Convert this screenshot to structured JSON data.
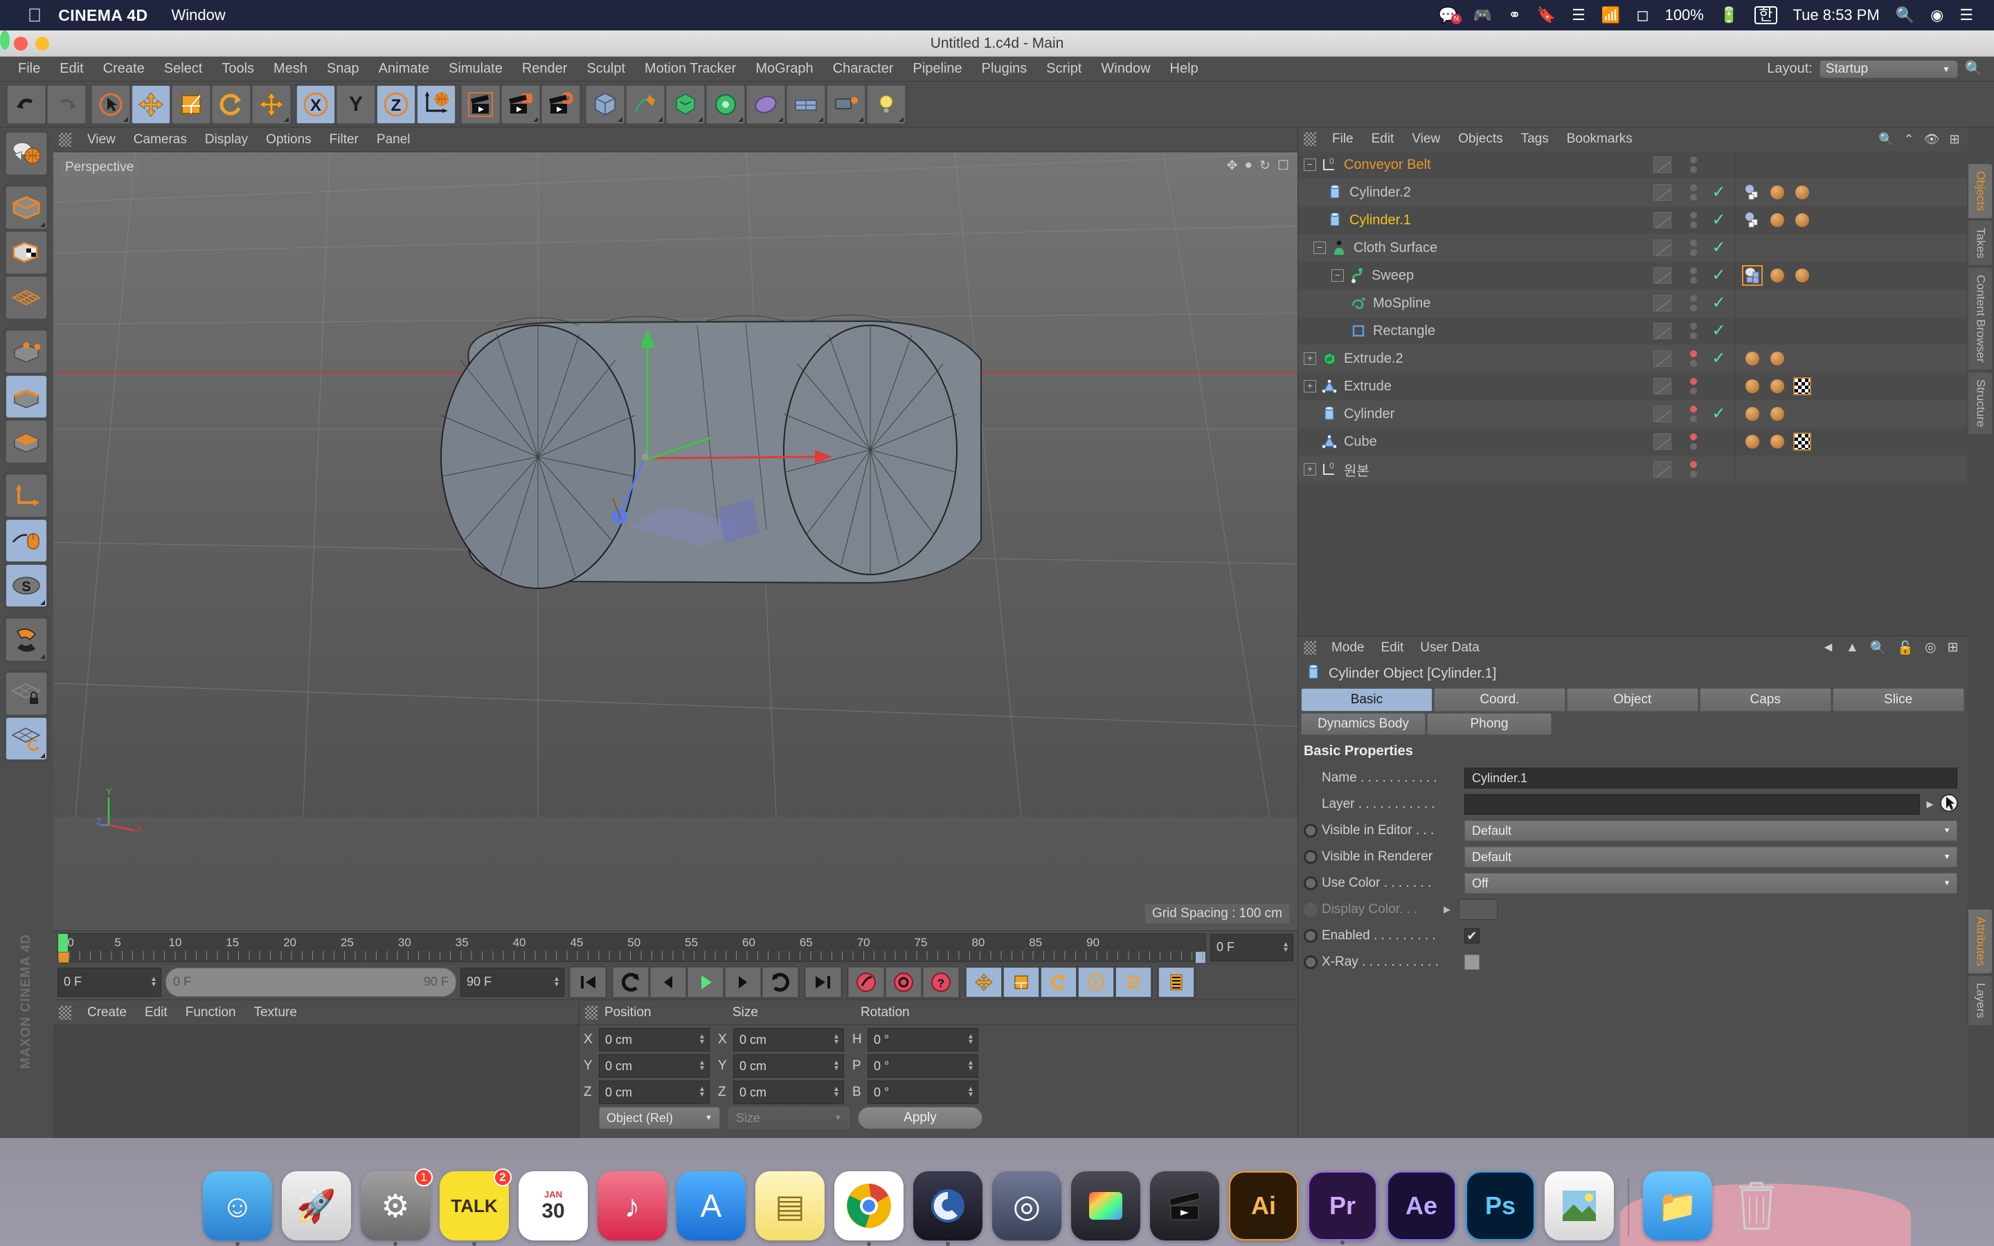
{
  "mac_menubar": {
    "apple_icon": "apple-icon",
    "app_name": "CINEMA 4D",
    "menus": [
      "Window"
    ],
    "status": {
      "battery_percent": "100%",
      "input_source": "한",
      "clock": "Tue 8:53 PM"
    },
    "icons": [
      "messages-icon",
      "discord-icon",
      "creative-cloud-icon",
      "bookmark-icon",
      "dropbox-icon",
      "wifi-icon",
      "airplay-icon",
      "battery-icon",
      "search-icon",
      "siri-icon",
      "control-center-icon"
    ]
  },
  "window": {
    "title": "Untitled 1.c4d - Main"
  },
  "app_menu": {
    "items": [
      "File",
      "Edit",
      "Create",
      "Select",
      "Tools",
      "Mesh",
      "Snap",
      "Animate",
      "Simulate",
      "Render",
      "Sculpt",
      "Motion Tracker",
      "MoGraph",
      "Character",
      "Pipeline",
      "Plugins",
      "Script",
      "Window",
      "Help"
    ],
    "layout_label": "Layout:",
    "layout_value": "Startup"
  },
  "toolbar": {
    "buttons": [
      {
        "name": "undo",
        "icon": "undo-arrow-icon",
        "active": false
      },
      {
        "name": "redo",
        "icon": "redo-arrow-icon",
        "active": false
      },
      {
        "name": "live-selection",
        "icon": "cursor-circle-icon",
        "active": false
      },
      {
        "name": "move",
        "icon": "move-arrows-icon",
        "active": true
      },
      {
        "name": "scale",
        "icon": "scale-box-icon",
        "active": false
      },
      {
        "name": "rotate",
        "icon": "rotate-circle-icon",
        "active": false
      },
      {
        "name": "move-alt",
        "icon": "move-arrows-icon",
        "active": false
      },
      {
        "name": "axis-x",
        "icon": "x-axis-icon",
        "active": true
      },
      {
        "name": "axis-y",
        "icon": "y-axis-icon",
        "active": false
      },
      {
        "name": "axis-z",
        "icon": "z-axis-icon",
        "active": true
      },
      {
        "name": "world-coordinates",
        "icon": "globe-axis-icon",
        "active": true
      },
      {
        "name": "render-view",
        "icon": "clapper-icon",
        "active": false
      },
      {
        "name": "render-picture-viewer",
        "icon": "clapper-window-icon",
        "active": false
      },
      {
        "name": "render-settings",
        "icon": "clapper-gear-icon",
        "active": false
      },
      {
        "name": "add-cube",
        "icon": "cube-icon",
        "active": false
      },
      {
        "name": "add-spline",
        "icon": "pen-spline-icon",
        "active": false
      },
      {
        "name": "add-generator",
        "icon": "generator-icon",
        "active": false
      },
      {
        "name": "add-deformer",
        "icon": "deformer-icon",
        "active": false
      },
      {
        "name": "add-scene",
        "icon": "environment-icon",
        "active": false
      },
      {
        "name": "add-camera",
        "icon": "camera-icon",
        "active": false
      },
      {
        "name": "add-light",
        "icon": "light-bulb-icon",
        "active": false
      }
    ]
  },
  "left_toolbar": {
    "buttons": [
      {
        "name": "render-mode",
        "icon": "sphere-globe-icon",
        "active": false
      },
      {
        "name": "make-editable",
        "icon": "editable-cube-icon",
        "active": false
      },
      {
        "name": "texture-axis",
        "icon": "checker-cube-icon",
        "active": false
      },
      {
        "name": "model-mode-grid",
        "icon": "grid-plane-icon",
        "active": false
      },
      {
        "name": "point-mode",
        "icon": "point-cube-icon",
        "active": false
      },
      {
        "name": "edge-mode",
        "icon": "edge-cube-icon",
        "active": true
      },
      {
        "name": "polygon-mode",
        "icon": "polygon-cube-icon",
        "active": false
      },
      {
        "name": "axis-mode",
        "icon": "axis-arrows-icon",
        "active": false
      },
      {
        "name": "viewport-solo",
        "icon": "mouse-icon",
        "active": true
      },
      {
        "name": "workplane",
        "icon": "s-disc-icon",
        "active": true
      },
      {
        "name": "snap-magnet",
        "icon": "magnet-icon",
        "active": false
      },
      {
        "name": "lock-workplane",
        "icon": "grid-lock-icon",
        "active": false
      },
      {
        "name": "planar-workplane",
        "icon": "grid-rotate-icon",
        "active": true
      }
    ],
    "brand": "MAXON CINEMA 4D"
  },
  "viewport": {
    "menu": [
      "View",
      "Cameras",
      "Display",
      "Options",
      "Filter",
      "Panel"
    ],
    "label": "Perspective",
    "grid_spacing": "Grid Spacing : 100 cm",
    "axis_labels": {
      "x": "X",
      "y": "Y",
      "z": "Z"
    }
  },
  "timeline": {
    "ticks": [
      "0",
      "5",
      "10",
      "15",
      "20",
      "25",
      "30",
      "35",
      "40",
      "45",
      "50",
      "55",
      "60",
      "65",
      "70",
      "75",
      "80",
      "85",
      "90"
    ],
    "current_frame": "0 F"
  },
  "anim_controls": {
    "start_field": "0 F",
    "range_start": "0 F",
    "range_end": "90 F",
    "end_field": "90 F",
    "buttons": [
      "go-to-start",
      "play-backwards-loop",
      "step-back",
      "play",
      "step-forward",
      "loop",
      "go-to-end",
      "record-keyframe",
      "autokey",
      "keyframe-selection",
      "position-key",
      "scale-key",
      "rotation-key",
      "parameter-key",
      "point-level-animation",
      "dope-sheet"
    ]
  },
  "material_manager": {
    "menu": [
      "Create",
      "Edit",
      "Function",
      "Texture"
    ]
  },
  "coordinates": {
    "headers": [
      "Position",
      "Size",
      "Rotation"
    ],
    "rows": [
      {
        "pos_label": "X",
        "pos_value": "0 cm",
        "size_label": "X",
        "size_value": "0 cm",
        "rot_label": "H",
        "rot_value": "0 °"
      },
      {
        "pos_label": "Y",
        "pos_value": "0 cm",
        "size_label": "Y",
        "size_value": "0 cm",
        "rot_label": "P",
        "rot_value": "0 °"
      },
      {
        "pos_label": "Z",
        "pos_value": "0 cm",
        "size_label": "Z",
        "size_value": "0 cm",
        "rot_label": "B",
        "rot_value": "0 °"
      }
    ],
    "mode_select": "Object (Rel)",
    "size_select": "Size",
    "apply_label": "Apply"
  },
  "object_manager": {
    "menu": [
      "File",
      "Edit",
      "View",
      "Objects",
      "Tags",
      "Bookmarks"
    ],
    "items": [
      {
        "name": "Conveyor Belt",
        "icon": "null-object-icon",
        "depth": 0,
        "expander": "minus",
        "color": "orange",
        "check": false,
        "dot_red": false,
        "tags": []
      },
      {
        "name": "Cylinder.2",
        "icon": "cylinder-icon",
        "depth": 1,
        "expander": "none",
        "color": "normal",
        "check": true,
        "dot_red": false,
        "tags": [
          "dynamics-tag",
          "sphere-tag",
          "sphere-tag"
        ]
      },
      {
        "name": "Cylinder.1",
        "icon": "cylinder-icon",
        "depth": 1,
        "expander": "none",
        "color": "yellow",
        "check": true,
        "dot_red": false,
        "tags": [
          "dynamics-tag",
          "sphere-tag",
          "sphere-tag"
        ]
      },
      {
        "name": "Cloth Surface",
        "icon": "cloth-surface-icon",
        "depth": 0,
        "expander": "minus",
        "color": "normal",
        "check": true,
        "dot_red": false,
        "tags": []
      },
      {
        "name": "Sweep",
        "icon": "sweep-icon",
        "depth": 1,
        "expander": "minus",
        "color": "normal",
        "check": true,
        "dot_red": false,
        "tags": [
          "cloth-tag-selected",
          "sphere-tag",
          "sphere-tag"
        ]
      },
      {
        "name": "MoSpline",
        "icon": "mospline-icon",
        "depth": 2,
        "expander": "none",
        "color": "normal",
        "check": true,
        "dot_red": false,
        "tags": []
      },
      {
        "name": "Rectangle",
        "icon": "rectangle-spline-icon",
        "depth": 2,
        "expander": "none",
        "color": "normal",
        "check": true,
        "dot_red": false,
        "tags": []
      },
      {
        "name": "Extrude.2",
        "icon": "extrude-green-icon",
        "depth": 0,
        "expander": "plus",
        "color": "normal",
        "check": true,
        "dot_red": true,
        "tags": [
          "sphere-tag",
          "sphere-tag"
        ]
      },
      {
        "name": "Extrude",
        "icon": "spline-tri-icon",
        "depth": 0,
        "expander": "plus",
        "color": "normal",
        "check": false,
        "dot_red": true,
        "tags": [
          "sphere-tag",
          "sphere-tag",
          "checker-tag"
        ]
      },
      {
        "name": "Cylinder",
        "icon": "cylinder-icon",
        "depth": 0,
        "expander": "none",
        "color": "normal",
        "check": true,
        "dot_red": true,
        "tags": [
          "sphere-tag",
          "sphere-tag"
        ]
      },
      {
        "name": "Cube",
        "icon": "spline-tri-icon",
        "depth": 0,
        "expander": "none",
        "color": "normal",
        "check": false,
        "dot_red": true,
        "tags": [
          "sphere-tag",
          "sphere-tag",
          "checker-tag"
        ]
      },
      {
        "name": "원본",
        "icon": "null-object-icon",
        "depth": 0,
        "expander": "plus",
        "color": "normal",
        "check": false,
        "dot_red": true,
        "tags": []
      }
    ]
  },
  "attributes": {
    "menu": [
      "Mode",
      "Edit",
      "User Data"
    ],
    "object_title": "Cylinder Object [Cylinder.1]",
    "tabs_row1": [
      "Basic",
      "Coord.",
      "Object",
      "Caps",
      "Slice"
    ],
    "tabs_row2": [
      "Dynamics Body",
      "Phong"
    ],
    "active_tab": "Basic",
    "section_title": "Basic Properties",
    "properties": [
      {
        "label": "Name . . . . . . . . . . .",
        "type": "input",
        "value": "Cylinder.1",
        "radio": false,
        "dim": false
      },
      {
        "label": "Layer . . . . . . . . . . .",
        "type": "layer",
        "value": "",
        "radio": false,
        "dim": false
      },
      {
        "label": "Visible in Editor . . .",
        "type": "select",
        "value": "Default",
        "radio": true,
        "dim": false
      },
      {
        "label": "Visible in Renderer",
        "type": "select",
        "value": "Default",
        "radio": true,
        "dim": false
      },
      {
        "label": "Use Color . . . . . . .",
        "type": "select",
        "value": "Off",
        "radio": true,
        "dim": false
      },
      {
        "label": "Display Color. . .",
        "type": "swatch",
        "value": "",
        "radio": true,
        "dim": true
      },
      {
        "label": "Enabled . . . . . . . . .",
        "type": "checkbox",
        "value": "✔",
        "radio": true,
        "dim": false
      },
      {
        "label": "X-Ray . . . . . . . . . . .",
        "type": "checkbox-empty",
        "value": "",
        "radio": true,
        "dim": false
      }
    ]
  },
  "right_tabs": {
    "top": [
      "Objects",
      "Takes",
      "Content Browser",
      "Structure"
    ],
    "top_active": "Objects",
    "bottom": [
      "Attributes",
      "Layers"
    ],
    "bottom_active": "Attributes"
  },
  "dock": {
    "items": [
      {
        "name": "finder",
        "label": "☺",
        "color": "#3ba7f0",
        "badge": ""
      },
      {
        "name": "launchpad",
        "label": "🚀",
        "color": "#d9d9d9",
        "badge": ""
      },
      {
        "name": "system-preferences",
        "label": "⚙",
        "color": "#8a8a8a",
        "badge": "1"
      },
      {
        "name": "kakaotalk",
        "label": "TALK",
        "color": "#f7e02e",
        "badge": "2"
      },
      {
        "name": "calendar",
        "label": "30",
        "color": "#ffffff",
        "badge": ""
      },
      {
        "name": "itunes",
        "label": "♪",
        "color": "#e8526b",
        "badge": ""
      },
      {
        "name": "app-store",
        "label": "A",
        "color": "#2c8ff0",
        "badge": ""
      },
      {
        "name": "notes",
        "label": "▤",
        "color": "#fce38a",
        "badge": ""
      },
      {
        "name": "chrome",
        "label": "◉",
        "color": "#ffffff",
        "badge": ""
      },
      {
        "name": "cinema-4d",
        "label": "C",
        "color": "#2b2b3c",
        "badge": ""
      },
      {
        "name": "media-player",
        "label": "◎",
        "color": "#4a4a5a",
        "badge": ""
      },
      {
        "name": "final-cut-pro",
        "label": "▦",
        "color": "#2d2d35",
        "badge": ""
      },
      {
        "name": "movie-app",
        "label": "🎬",
        "color": "#3a3a42",
        "badge": ""
      },
      {
        "name": "illustrator",
        "label": "Ai",
        "color": "#2a1a06",
        "badge": ""
      },
      {
        "name": "premiere-pro",
        "label": "Pr",
        "color": "#2a1540",
        "badge": ""
      },
      {
        "name": "after-effects",
        "label": "Ae",
        "color": "#1a1036",
        "badge": ""
      },
      {
        "name": "photoshop",
        "label": "Ps",
        "color": "#031c33",
        "badge": ""
      },
      {
        "name": "preview",
        "label": "🖼",
        "color": "#e8e8e8",
        "badge": ""
      },
      {
        "name": "downloads-folder",
        "label": "📁",
        "color": "#4aaef0",
        "badge": ""
      },
      {
        "name": "trash",
        "label": "🗑",
        "color": "#c8c8c8",
        "badge": ""
      }
    ]
  }
}
